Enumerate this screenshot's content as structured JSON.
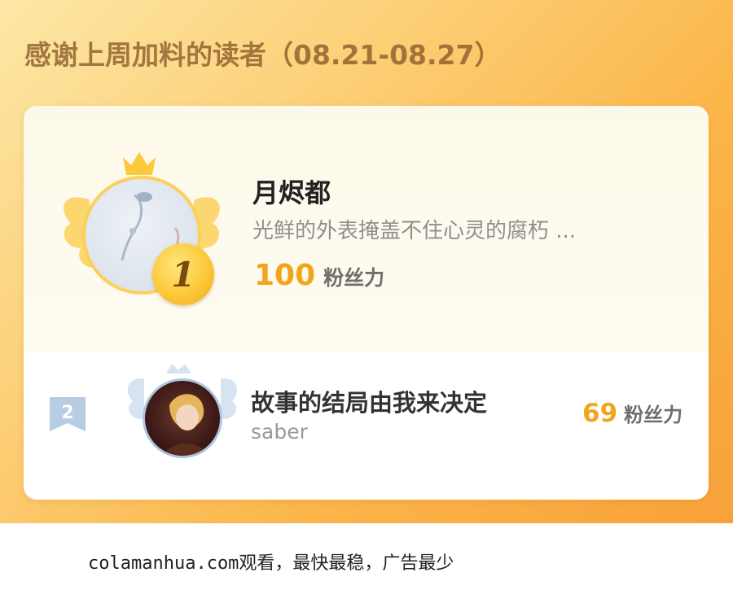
{
  "banner": {
    "title": "感谢上周加料的读者（08.21-08.27）"
  },
  "rank1": {
    "rank": "1",
    "name": "月烬都",
    "motto": "光鲜的外表掩盖不住心灵的腐朽 ...",
    "fans_value": "100",
    "fans_unit": "粉丝力"
  },
  "rank2": {
    "rank": "2",
    "name": "故事的结局由我来决定",
    "motto": "saber",
    "fans_value": "69",
    "fans_unit": "粉丝力"
  },
  "footer": {
    "text": "colamanhua.com观看，最快最稳，广告最少"
  },
  "colors": {
    "gold": "#f2a51b",
    "banner_orange": "#f8a13a",
    "silver_blue": "#aec4df"
  },
  "icons": {
    "crown": "crown-icon",
    "wings": "wings-icon",
    "rank_badge": "medal-icon",
    "rank_flag": "ribbon-flag-icon"
  }
}
